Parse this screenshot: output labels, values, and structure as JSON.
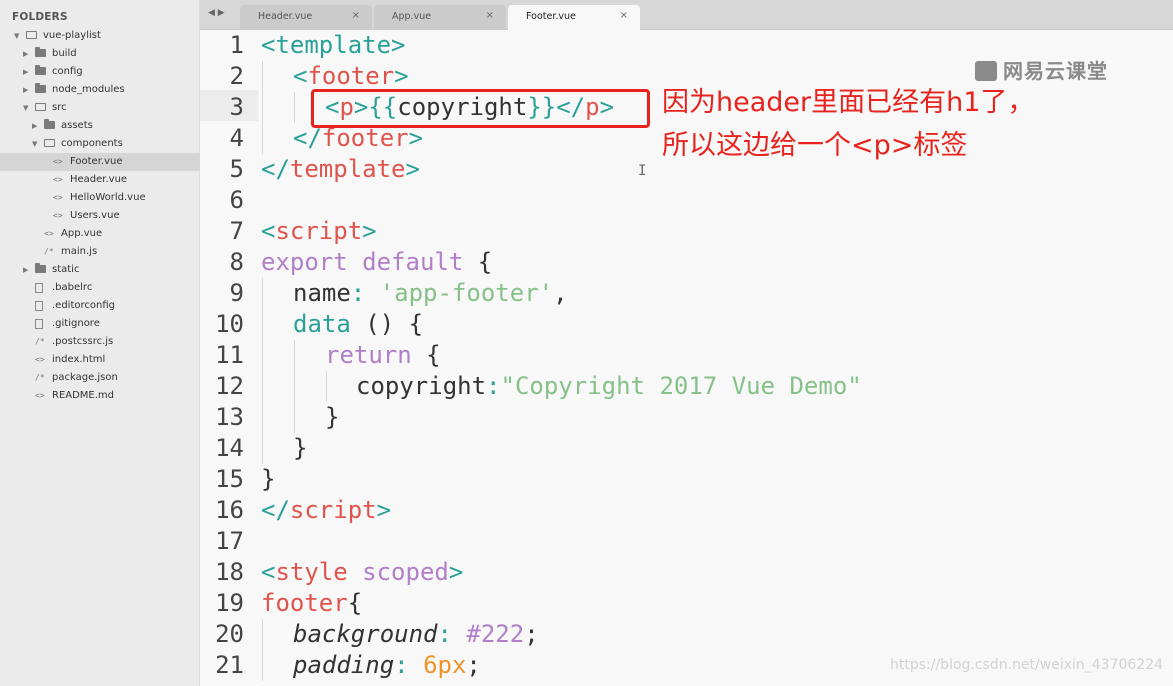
{
  "sidebar": {
    "title": "FOLDERS",
    "items": [
      {
        "label": "vue-playlist",
        "type": "folder-open"
      },
      {
        "label": "build",
        "type": "folder"
      },
      {
        "label": "config",
        "type": "folder"
      },
      {
        "label": "node_modules",
        "type": "folder"
      },
      {
        "label": "src",
        "type": "folder-open"
      },
      {
        "label": "assets",
        "type": "folder"
      },
      {
        "label": "components",
        "type": "folder-open"
      },
      {
        "label": "Footer.vue",
        "type": "code"
      },
      {
        "label": "Header.vue",
        "type": "code"
      },
      {
        "label": "HelloWorld.vue",
        "type": "code"
      },
      {
        "label": "Users.vue",
        "type": "code"
      },
      {
        "label": "App.vue",
        "type": "code"
      },
      {
        "label": "main.js",
        "type": "comment"
      },
      {
        "label": "static",
        "type": "folder"
      },
      {
        "label": ".babelrc",
        "type": "file"
      },
      {
        "label": ".editorconfig",
        "type": "file"
      },
      {
        "label": ".gitignore",
        "type": "file"
      },
      {
        "label": ".postcssrc.js",
        "type": "comment"
      },
      {
        "label": "index.html",
        "type": "code"
      },
      {
        "label": "package.json",
        "type": "comment"
      },
      {
        "label": "README.md",
        "type": "code"
      }
    ],
    "selected": "Footer.vue"
  },
  "tabs": {
    "nav": "◀ ▶",
    "close_symbol": "×",
    "items": [
      {
        "label": "Header.vue",
        "active": false
      },
      {
        "label": "App.vue",
        "active": false
      },
      {
        "label": "Footer.vue",
        "active": true
      }
    ]
  },
  "editor": {
    "current_line": 3,
    "lines": [
      {
        "n": "1"
      },
      {
        "n": "2"
      },
      {
        "n": "3"
      },
      {
        "n": "4"
      },
      {
        "n": "5"
      },
      {
        "n": "6"
      },
      {
        "n": "7"
      },
      {
        "n": "8"
      },
      {
        "n": "9"
      },
      {
        "n": "10"
      },
      {
        "n": "11"
      },
      {
        "n": "12"
      },
      {
        "n": "13"
      },
      {
        "n": "14"
      },
      {
        "n": "15"
      },
      {
        "n": "16"
      },
      {
        "n": "17"
      },
      {
        "n": "18"
      },
      {
        "n": "19"
      },
      {
        "n": "20"
      },
      {
        "n": "21"
      }
    ],
    "code": {
      "l1": [
        "<",
        "template",
        ">"
      ],
      "l2": [
        "<",
        "footer",
        ">"
      ],
      "l3": [
        "<",
        "p",
        ">",
        "{{",
        "copyright",
        "}}",
        "</",
        "p",
        ">"
      ],
      "l4": [
        "</",
        "footer",
        ">"
      ],
      "l5": [
        "</",
        "template",
        ">"
      ],
      "l7": [
        "<",
        "script",
        ">"
      ],
      "l8": [
        "export",
        " default",
        " {"
      ],
      "l9": [
        "name",
        ": ",
        "'app-footer'",
        ","
      ],
      "l10": [
        "data",
        " () {"
      ],
      "l11": [
        "return",
        " {"
      ],
      "l12": [
        "copyright",
        ":",
        "\"Copyright 2017 Vue Demo\""
      ],
      "l13": [
        "}"
      ],
      "l14": [
        "}"
      ],
      "l15": [
        "}"
      ],
      "l16": [
        "</",
        "script",
        ">"
      ],
      "l18": [
        "<",
        "style",
        " scoped",
        ">"
      ],
      "l19": [
        "footer",
        "{"
      ],
      "l20": [
        "background",
        ": ",
        "#222",
        ";"
      ],
      "l21": [
        "padding",
        ": ",
        "6px",
        ";"
      ]
    }
  },
  "annotation": {
    "line1": "因为header里面已经有h1了，",
    "line2": "所以这边给一个<p>标签",
    "color": "#e8231d"
  },
  "watermark": {
    "logo": "网易云课堂",
    "url": "https://blog.csdn.net/weixin_43706224"
  }
}
